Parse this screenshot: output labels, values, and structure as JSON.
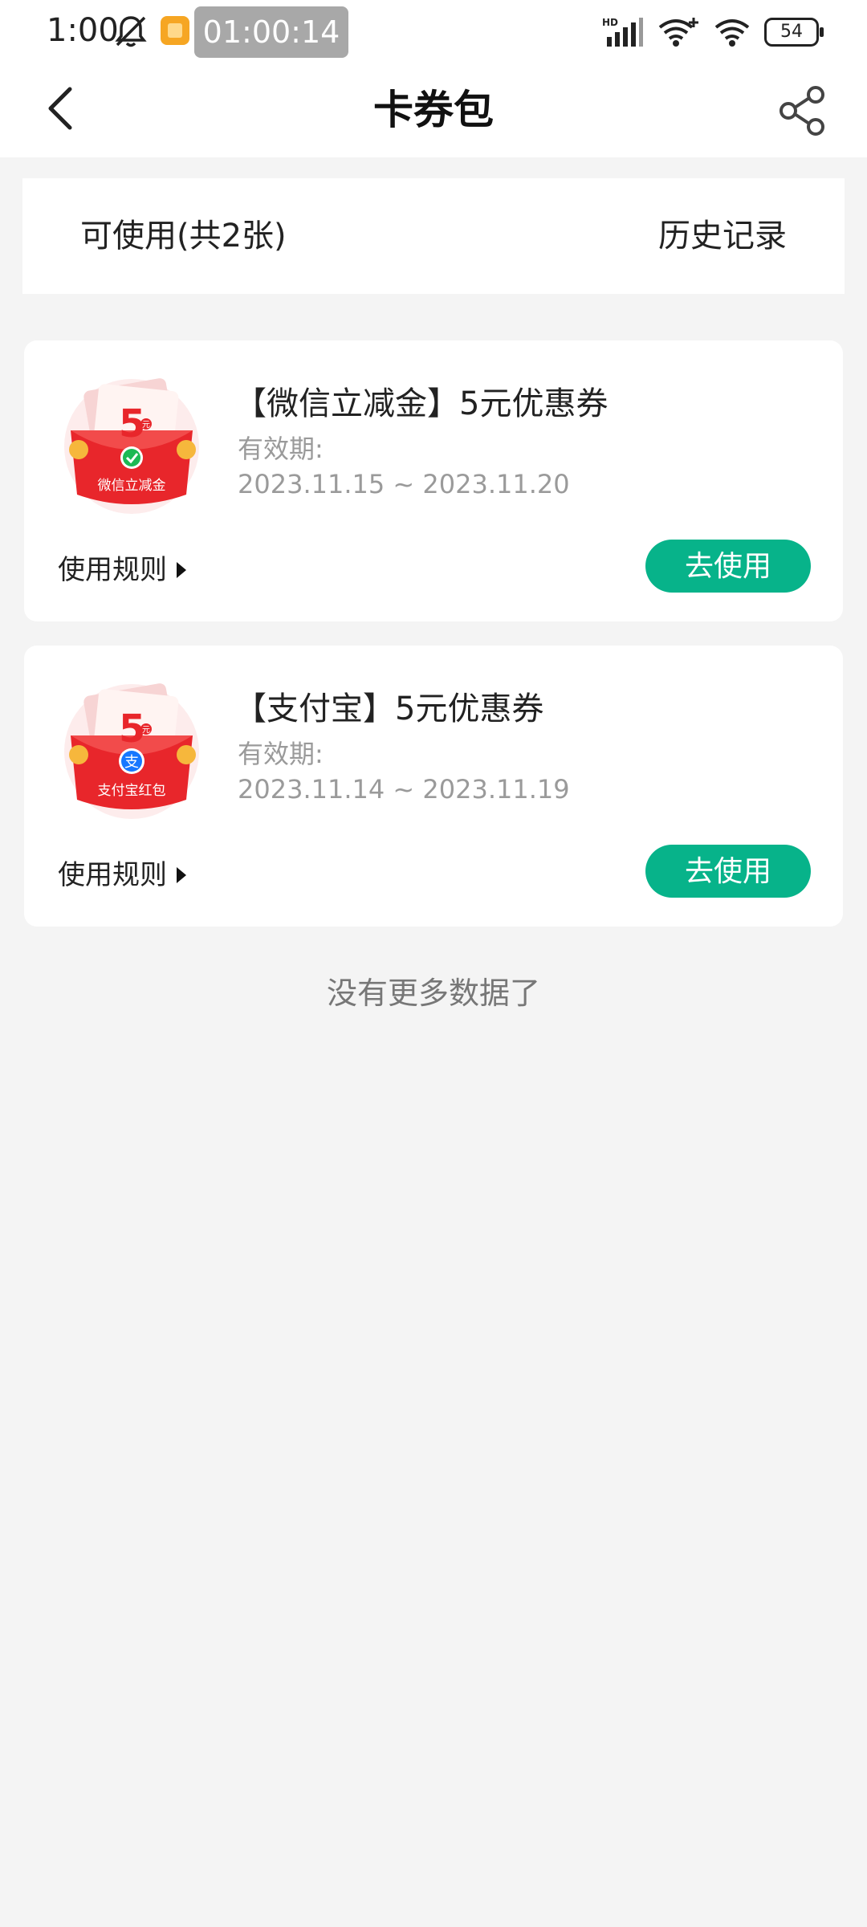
{
  "status_bar": {
    "time": "1:00",
    "timer": "01:00:14",
    "network_label": "HD",
    "battery": "54",
    "icons": [
      "mute-bell-icon",
      "app-notification-icon",
      "signal-icon",
      "wifi-plus-icon",
      "wifi-icon",
      "battery-icon"
    ]
  },
  "header": {
    "title": "卡券包",
    "back_icon": "chevron-left-icon",
    "share_icon": "share-icon"
  },
  "tabs": {
    "available": "可使用(共2张)",
    "history": "历史记录"
  },
  "coupons": [
    {
      "name": "【微信立减金】5元优惠券",
      "valid_label": "有效期:",
      "valid_range": "2023.11.15 ~ 2023.11.20",
      "logo_amount": "5",
      "logo_unit": "元",
      "logo_caption": "微信立减金",
      "rules_label": "使用规则",
      "use_label": "去使用",
      "badge_color": "#1db954"
    },
    {
      "name": "【支付宝】5元优惠券",
      "valid_label": "有效期:",
      "valid_range": "2023.11.14 ~ 2023.11.19",
      "logo_amount": "5",
      "logo_unit": "元",
      "logo_caption": "支付宝红包",
      "logo_badge_text": "支",
      "rules_label": "使用规则",
      "use_label": "去使用",
      "badge_color": "#1677ff"
    }
  ],
  "footer": {
    "no_more": "没有更多数据了"
  },
  "colors": {
    "accent": "#07b38a",
    "background": "#f4f4f4",
    "card": "#ffffff",
    "logo_red": "#e8262b"
  }
}
